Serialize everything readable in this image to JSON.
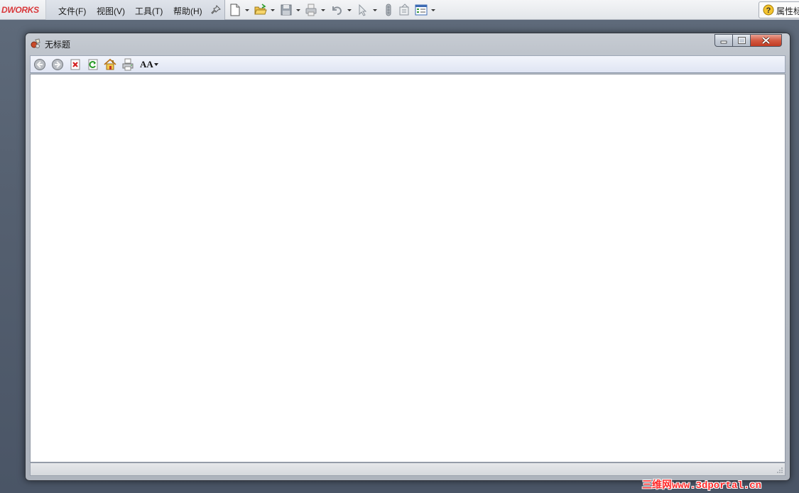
{
  "app": {
    "brand": "DWORKS",
    "menu": [
      "文件(F)",
      "视图(V)",
      "工具(T)",
      "帮助(H)"
    ],
    "toolbar_icons": [
      "new-document-icon",
      "open-folder-icon",
      "save-icon",
      "print-icon",
      "undo-icon",
      "select-arrow-icon",
      "rebuild-icon",
      "file-properties-icon",
      "options-icon"
    ],
    "help_label": "属性标"
  },
  "window": {
    "title": "无标题",
    "toolbar": [
      "back-icon",
      "forward-icon",
      "stop-icon",
      "refresh-icon",
      "home-icon",
      "print-icon",
      "font-size-icon"
    ],
    "font_button_label": "AA"
  },
  "watermark": "三维网www.3dportal.cn",
  "colors": {
    "brand": "#d9383a",
    "desktop": "#556070",
    "close_button": "#c13b22",
    "content_bg": "#ffffff"
  }
}
